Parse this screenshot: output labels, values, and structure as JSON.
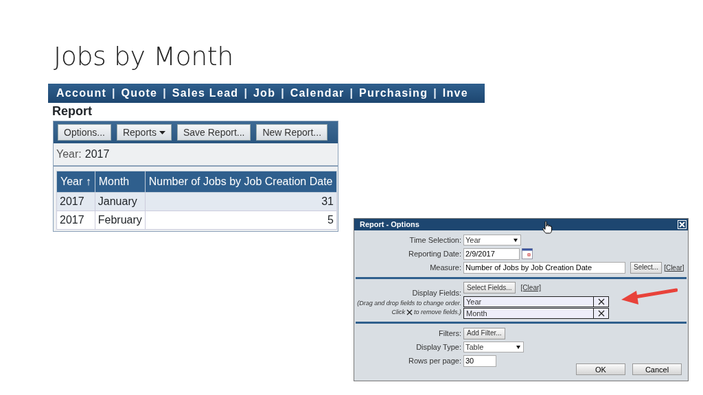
{
  "slide_title": "Jobs by Month",
  "app": {
    "nav": [
      {
        "kind": "link",
        "label": "Account"
      },
      {
        "kind": "separator",
        "label": "|"
      },
      {
        "kind": "link",
        "label": "Quote"
      },
      {
        "kind": "separator",
        "label": "|"
      },
      {
        "kind": "link",
        "label": "Sales Lead"
      },
      {
        "kind": "separator",
        "label": "|"
      },
      {
        "kind": "link",
        "label": "Job"
      },
      {
        "kind": "separator",
        "label": "|"
      },
      {
        "kind": "link",
        "label": "Calendar"
      },
      {
        "kind": "separator",
        "label": "|"
      },
      {
        "kind": "link",
        "label": "Purchasing"
      },
      {
        "kind": "separator",
        "label": "|"
      },
      {
        "kind": "link",
        "label": "Inve"
      }
    ],
    "page_title": "Report",
    "toolbar": [
      {
        "label": "Options...",
        "dropdown": false
      },
      {
        "label": "Reports",
        "dropdown": true
      },
      {
        "label": "Save Report...",
        "dropdown": false
      },
      {
        "label": "New Report...",
        "dropdown": false
      }
    ],
    "year_label": "Year:",
    "year_value": "2017",
    "table": {
      "columns": [
        "Year ↑",
        "Month",
        "Number of Jobs by Job Creation Date"
      ],
      "rows": [
        {
          "cells": [
            "2017",
            "January",
            "31"
          ],
          "selected": true
        },
        {
          "cells": [
            "2017",
            "February",
            "5"
          ],
          "selected": false
        }
      ]
    }
  },
  "dialog": {
    "title": "Report - Options",
    "section_1": [
      {
        "kind": "select",
        "label": "Time Selection:",
        "value": "Year"
      },
      {
        "kind": "date",
        "label": "Reporting Date:",
        "value": "2/9/2017"
      },
      {
        "kind": "measure",
        "label": "Measure:",
        "value": "Number of Jobs by Job Creation Date",
        "button": "Select...",
        "link": "[Clear]"
      }
    ],
    "display_fields": {
      "label": "Display Fields:",
      "hint_1": "(Drag and drop fields to change order.",
      "hint_2a": "Click",
      "hint_2b": "to remove fields.)",
      "button": "Select Fields...",
      "link": "[Clear]",
      "fields": [
        "Year",
        "Month"
      ]
    },
    "section_3": [
      {
        "kind": "button",
        "label": "Filters:",
        "value": "Add Filter..."
      },
      {
        "kind": "select",
        "label": "Display Type:",
        "value": "Table"
      },
      {
        "kind": "text",
        "label": "Rows per page:",
        "value": "30"
      }
    ],
    "buttons": [
      "OK",
      "Cancel"
    ]
  }
}
